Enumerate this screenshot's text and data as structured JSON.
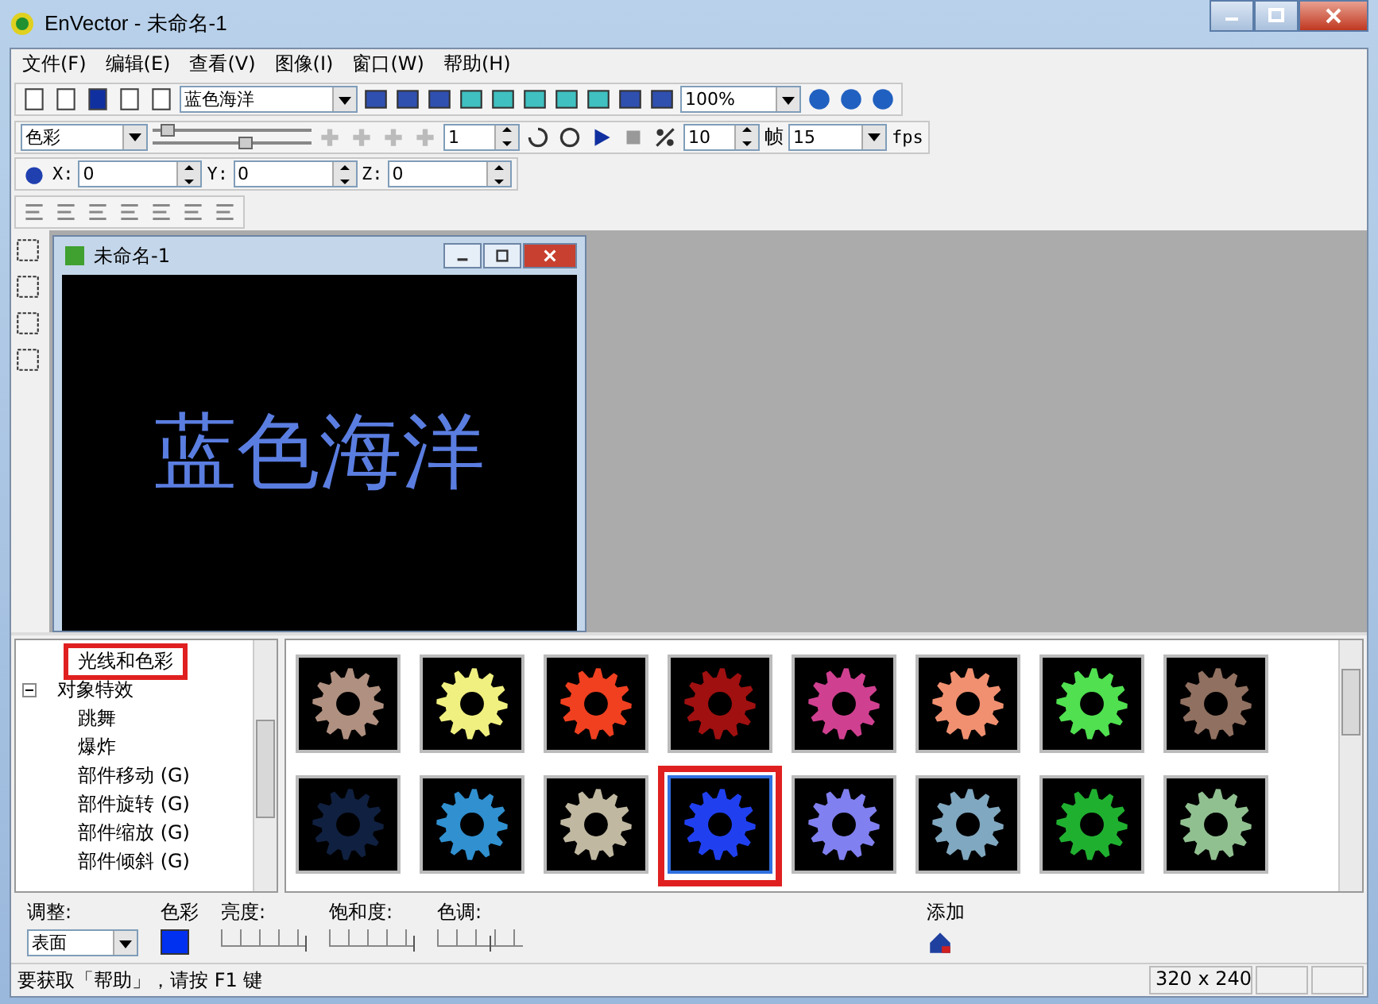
{
  "window": {
    "title": "EnVector - 未命名-1"
  },
  "menu": [
    {
      "label": "文件(F)"
    },
    {
      "label": "编辑(E)"
    },
    {
      "label": "查看(V)"
    },
    {
      "label": "图像(I)"
    },
    {
      "label": "窗口(W)"
    },
    {
      "label": "帮助(H)"
    }
  ],
  "toolbar1": {
    "text_dropdown": "蓝色海洋",
    "zoom_dropdown": "100%"
  },
  "toolbar2": {
    "mode_dropdown": "色彩",
    "sliders": [
      {
        "level": 0.05
      },
      {
        "level": 0.6
      }
    ],
    "frame_spin": "1",
    "step_spin": "10",
    "frame_label": "帧",
    "fps_dropdown": "15",
    "fps_label": "fps"
  },
  "toolbar3": {
    "coords": [
      {
        "label": "X:",
        "value": "0"
      },
      {
        "label": "Y:",
        "value": "0"
      },
      {
        "label": "Z:",
        "value": "0"
      }
    ]
  },
  "document": {
    "title": "未命名-1",
    "canvas_text": "蓝色海洋"
  },
  "tree": [
    {
      "label": "光线和色彩",
      "marked": true
    },
    {
      "label": "对象特效",
      "expanded": true,
      "marked": false,
      "children": [
        {
          "label": "跳舞",
          "marked": false
        },
        {
          "label": "爆炸",
          "marked": false
        },
        {
          "label": "部件移动 (G)",
          "marked": false
        },
        {
          "label": "部件旋转 (G)",
          "marked": false
        },
        {
          "label": "部件缩放 (G)",
          "marked": false
        },
        {
          "label": "部件倾斜 (G)",
          "marked": false
        }
      ]
    }
  ],
  "thumbnails": [
    {
      "color": "#b09080",
      "selected": false,
      "marked": false
    },
    {
      "color": "#f0f080",
      "selected": false,
      "marked": false
    },
    {
      "color": "#f04020",
      "selected": false,
      "marked": false
    },
    {
      "color": "#a01010",
      "selected": false,
      "marked": false
    },
    {
      "color": "#d04090",
      "selected": false,
      "marked": false
    },
    {
      "color": "#f09070",
      "selected": false,
      "marked": false
    },
    {
      "color": "#50e050",
      "selected": false,
      "marked": false
    },
    {
      "color": "#907060",
      "selected": false,
      "marked": false
    },
    {
      "color": "#102040",
      "selected": false,
      "marked": false
    },
    {
      "color": "#3090d0",
      "selected": false,
      "marked": false
    },
    {
      "color": "#c0b8a0",
      "selected": false,
      "marked": false
    },
    {
      "color": "#2040f0",
      "selected": true,
      "marked": true
    },
    {
      "color": "#8080f0",
      "selected": false,
      "marked": false
    },
    {
      "color": "#80a8c0",
      "selected": false,
      "marked": false
    },
    {
      "color": "#20b030",
      "selected": false,
      "marked": false
    },
    {
      "color": "#90c090",
      "selected": false,
      "marked": false
    }
  ],
  "adjust": {
    "label": "调整:",
    "dropdown": "表面",
    "color_label": "色彩",
    "color": "#0030f0",
    "sliders": [
      {
        "label": "亮度:",
        "level": 1
      },
      {
        "label": "饱和度:",
        "level": 1
      },
      {
        "label": "色调:",
        "level": 0.6
      }
    ],
    "add_label": "添加"
  },
  "status_bar": {
    "message": "要获取「帮助」，请按 F1 键",
    "size": "320 x 240"
  }
}
